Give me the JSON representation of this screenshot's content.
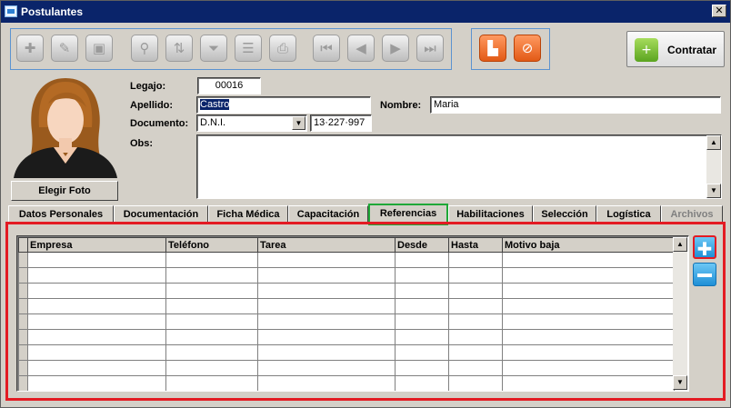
{
  "window": {
    "title": "Postulantes",
    "close": "✕"
  },
  "toolbar": {
    "buttons": [
      {
        "name": "add",
        "glyph": "✚"
      },
      {
        "name": "edit",
        "glyph": "✎"
      },
      {
        "name": "delete",
        "glyph": "▣"
      },
      {
        "name": "search",
        "glyph": "⚲"
      },
      {
        "name": "sort",
        "glyph": "⇅"
      },
      {
        "name": "filter",
        "glyph": "⏷"
      },
      {
        "name": "report",
        "glyph": "☰"
      },
      {
        "name": "print",
        "glyph": "⎙"
      },
      {
        "name": "first",
        "glyph": "⏮"
      },
      {
        "name": "prev",
        "glyph": "◀"
      },
      {
        "name": "next",
        "glyph": "▶"
      },
      {
        "name": "last",
        "glyph": "⏭"
      }
    ],
    "save_glyph": "▙",
    "cancel_glyph": "⊘"
  },
  "contratar": {
    "label": "Contratar",
    "icon": "user-add-icon",
    "glyph": "+"
  },
  "photo": {
    "button_label": "Elegir Foto"
  },
  "form": {
    "legajo_label": "Legajo:",
    "legajo": "00016",
    "apellido_label": "Apellido:",
    "apellido": "Castro",
    "nombre_label": "Nombre:",
    "nombre": "Maria",
    "documento_label": "Documento:",
    "doc_tipo": "D.N.I.",
    "doc_numero": "13·227·997",
    "obs_label": "Obs:",
    "obs": ""
  },
  "tabs": [
    "Datos Personales",
    "Documentación",
    "Ficha Médica",
    "Capacitación",
    "Referencias",
    "Habilitaciones",
    "Selección",
    "Logística",
    "Archivos"
  ],
  "active_tab": "Referencias",
  "grid": {
    "columns": [
      "Empresa",
      "Teléfono",
      "Tarea",
      "Desde",
      "Hasta",
      "Motivo baja"
    ],
    "rows": [
      [
        "",
        "",
        "",
        "",
        "",
        ""
      ],
      [
        "",
        "",
        "",
        "",
        "",
        ""
      ],
      [
        "",
        "",
        "",
        "",
        "",
        ""
      ],
      [
        "",
        "",
        "",
        "",
        "",
        ""
      ],
      [
        "",
        "",
        "",
        "",
        "",
        ""
      ],
      [
        "",
        "",
        "",
        "",
        "",
        ""
      ],
      [
        "",
        "",
        "",
        "",
        "",
        ""
      ],
      [
        "",
        "",
        "",
        "",
        "",
        ""
      ],
      [
        "",
        "",
        "",
        "",
        "",
        ""
      ]
    ]
  },
  "colors": {
    "title_bar": "#0a246a",
    "highlight": "#e31b23",
    "active_tab": "#1fa838",
    "toolbar_border": "#5c93d0"
  }
}
